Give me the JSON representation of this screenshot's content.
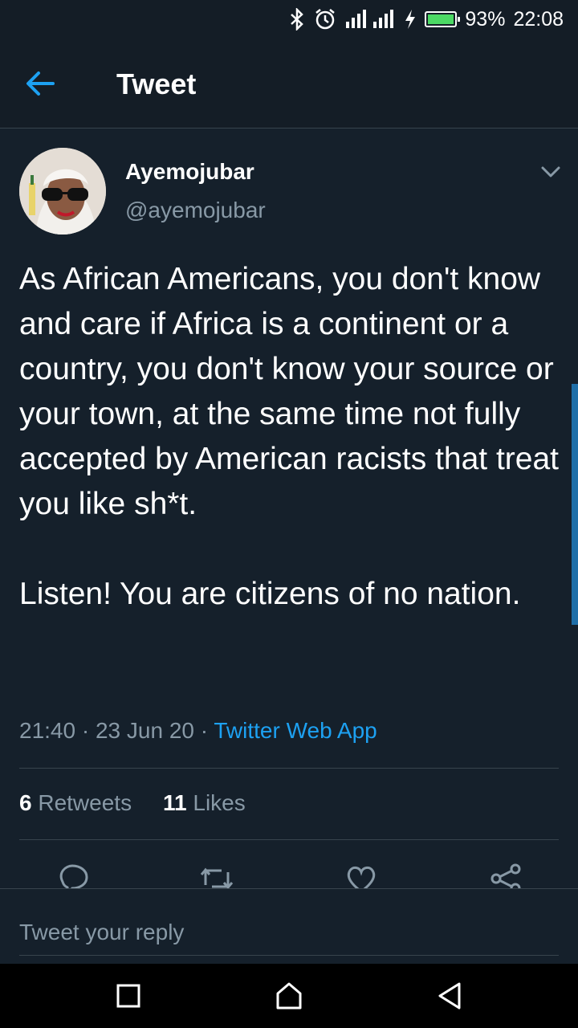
{
  "status_bar": {
    "battery": "93%",
    "battery_level": 0.93,
    "time": "22:08"
  },
  "header": {
    "title": "Tweet"
  },
  "tweet": {
    "author_name": "Ayemojubar",
    "author_handle": "@ayemojubar",
    "text": "As African Americans, you don't know and care if Africa is a continent or a country, you don't know your source or your town, at the same time not fully accepted by American racists that treat you like sh*t.\n\nListen! You are citizens of no nation.",
    "time": "21:40",
    "date": "23 Jun 20",
    "source": "Twitter Web App",
    "retweets_count": "6",
    "retweets_label": "Retweets",
    "likes_count": "11",
    "likes_label": "Likes"
  },
  "reply": {
    "placeholder": "Tweet your reply"
  },
  "colors": {
    "background": "#15202b",
    "accent": "#1da1f2",
    "muted": "#8899a6",
    "divider": "#38444d"
  },
  "icons": [
    "bluetooth-icon",
    "alarm-icon",
    "signal-icon",
    "charging-icon",
    "battery-icon",
    "back-arrow-icon",
    "chevron-down-icon",
    "reply-icon",
    "retweet-icon",
    "like-icon",
    "share-icon",
    "recents-icon",
    "home-icon",
    "back-icon"
  ]
}
